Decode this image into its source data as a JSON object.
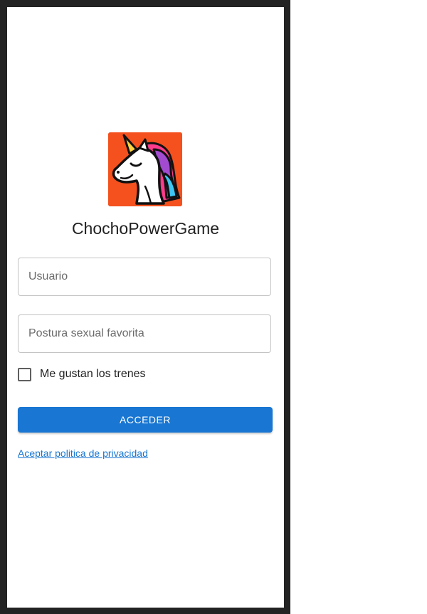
{
  "app": {
    "title": "ChochoPowerGame"
  },
  "logo": {
    "icon": "unicorn-icon",
    "background": "#f4511e"
  },
  "form": {
    "username": {
      "placeholder": "Usuario",
      "value": ""
    },
    "position": {
      "placeholder": "Postura sexual favorita",
      "value": ""
    },
    "checkbox": {
      "label": "Me gustan los trenes",
      "checked": false
    },
    "submit_label": "ACCEDER",
    "privacy_link": "Aceptar politica de privacidad"
  },
  "colors": {
    "primary": "#1976d2",
    "frame": "#232323",
    "text": "#212121"
  }
}
